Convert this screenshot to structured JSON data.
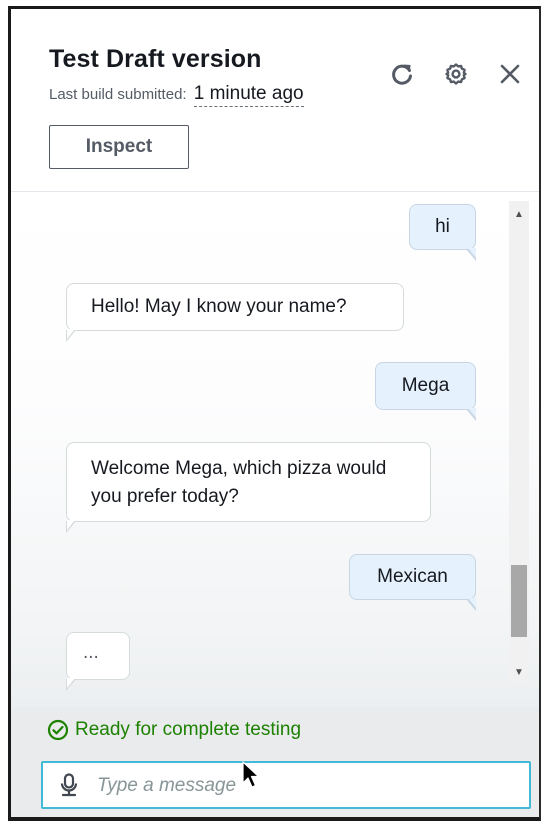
{
  "header": {
    "title": "Test Draft version",
    "subtitle_label": "Last build submitted:",
    "subtitle_time": "1 minute ago",
    "inspect_label": "Inspect",
    "icons": [
      "refresh-icon",
      "settings-icon",
      "close-icon"
    ]
  },
  "messages": [
    {
      "sender": "user",
      "text": "hi"
    },
    {
      "sender": "bot",
      "text": "Hello! May I know your name?"
    },
    {
      "sender": "user",
      "text": "Mega"
    },
    {
      "sender": "bot",
      "text": "Welcome Mega, which pizza would you prefer today?"
    },
    {
      "sender": "user",
      "text": "Mexican"
    },
    {
      "sender": "bot",
      "text": "..."
    }
  ],
  "footer": {
    "status": "Ready for complete testing",
    "input_placeholder": "Type a message",
    "input_value": ""
  },
  "colors": {
    "status_green": "#1d8102",
    "user_bubble": "#e5f1fc",
    "input_focus": "#44b9d6"
  }
}
